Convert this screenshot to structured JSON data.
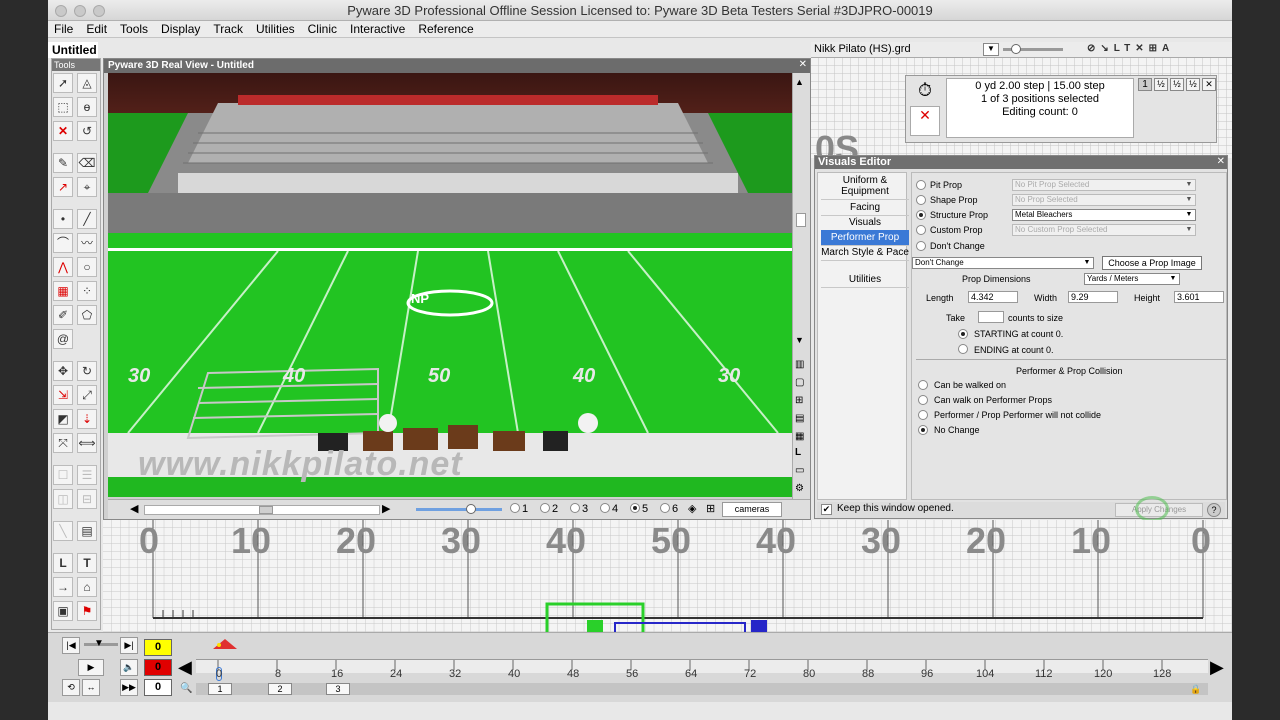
{
  "window": {
    "title": "Pyware 3D Professional   Offline Session   Licensed to: Pyware 3D Beta Testers   Serial #3DJPRO-00019"
  },
  "menu": [
    "File",
    "Edit",
    "Tools",
    "Display",
    "Track",
    "Utilities",
    "Clinic",
    "Interactive",
    "Reference"
  ],
  "document": {
    "title": "Untitled"
  },
  "tools_panel": {
    "title": "Tools"
  },
  "real_view": {
    "title": "Pyware 3D Real View - Untitled",
    "field_numbers": [
      "30",
      "40",
      "50",
      "40",
      "30"
    ],
    "midfield_logo": "NP",
    "endzone_text": "www.nikkpilato.net",
    "camera_presets": [
      "1",
      "2",
      "3",
      "4",
      "5",
      "6"
    ],
    "selected_camera": "5",
    "cameras_label": "cameras"
  },
  "grid_bar": {
    "file": "Nikk Pilato (HS).grd"
  },
  "selection_panel": {
    "position": "0 yd 2.00 step | 15.00 step",
    "selected": "1 of 3 positions selected",
    "editing": "Editing count: 0",
    "page_button": "1",
    "fraction_buttons": [
      "½",
      "½",
      "½"
    ]
  },
  "visuals_editor": {
    "title": "Visuals Editor",
    "tabs": [
      "Uniform & Equipment",
      "Facing",
      "Visuals",
      "Performer Prop",
      "March Style & Pace",
      "Utilities"
    ],
    "selected_tab": "Performer Prop",
    "prop_types": [
      {
        "label": "Pit Prop",
        "value": "No Pit Prop Selected",
        "checked": false,
        "enabled": false
      },
      {
        "label": "Shape Prop",
        "value": "No Prop Selected",
        "checked": false,
        "enabled": false
      },
      {
        "label": "Structure Prop",
        "value": "Metal Bleachers",
        "checked": true,
        "enabled": true
      },
      {
        "label": "Custom Prop",
        "value": "No Custom Prop Selected",
        "checked": false,
        "enabled": false
      },
      {
        "label": "Don't Change",
        "value": "",
        "checked": false,
        "enabled": true
      }
    ],
    "image_select": "Don't Change",
    "choose_image_button": "Choose a Prop Image",
    "dimensions_label": "Prop Dimensions",
    "units": "Yards / Meters",
    "length_label": "Length",
    "length": "4.342",
    "width_label": "Width",
    "width": "9.29",
    "height_label": "Height",
    "height": "3.601",
    "take_label": "Take",
    "take_value": "",
    "counts_label": "counts to size",
    "starting": "STARTING at count 0.",
    "ending": "ENDING at count 0.",
    "collision_title": "Performer & Prop Collision",
    "collision_options": [
      {
        "label": "Can be walked on",
        "checked": false
      },
      {
        "label": "Can walk on Performer Props",
        "checked": false
      },
      {
        "label": "Performer / Prop Performer will not collide",
        "checked": false
      },
      {
        "label": "No Change",
        "checked": true
      }
    ],
    "keep_open": "Keep this window opened.",
    "apply_button": "Apply Changes",
    "help_icon": "?"
  },
  "field_grid": {
    "yard_numbers": [
      "0",
      "10",
      "20",
      "30",
      "40",
      "50",
      "40",
      "30",
      "20",
      "10",
      "0"
    ],
    "top_fragment": "0S"
  },
  "timeline": {
    "counters": [
      {
        "value": "0",
        "color": "#ffff00"
      },
      {
        "value": "0",
        "color": "#e00000"
      },
      {
        "value": "0",
        "color": "#ffffff"
      }
    ],
    "ticks": [
      "0",
      "8",
      "16",
      "24",
      "32",
      "40",
      "48",
      "56",
      "64",
      "72",
      "80",
      "88",
      "96",
      "104",
      "112",
      "120",
      "128"
    ],
    "pages": [
      "1",
      "2",
      "3"
    ]
  },
  "colors": {
    "accent": "#3a79d6",
    "field_green": "#22c422",
    "stadium": "#9a9a9a"
  }
}
